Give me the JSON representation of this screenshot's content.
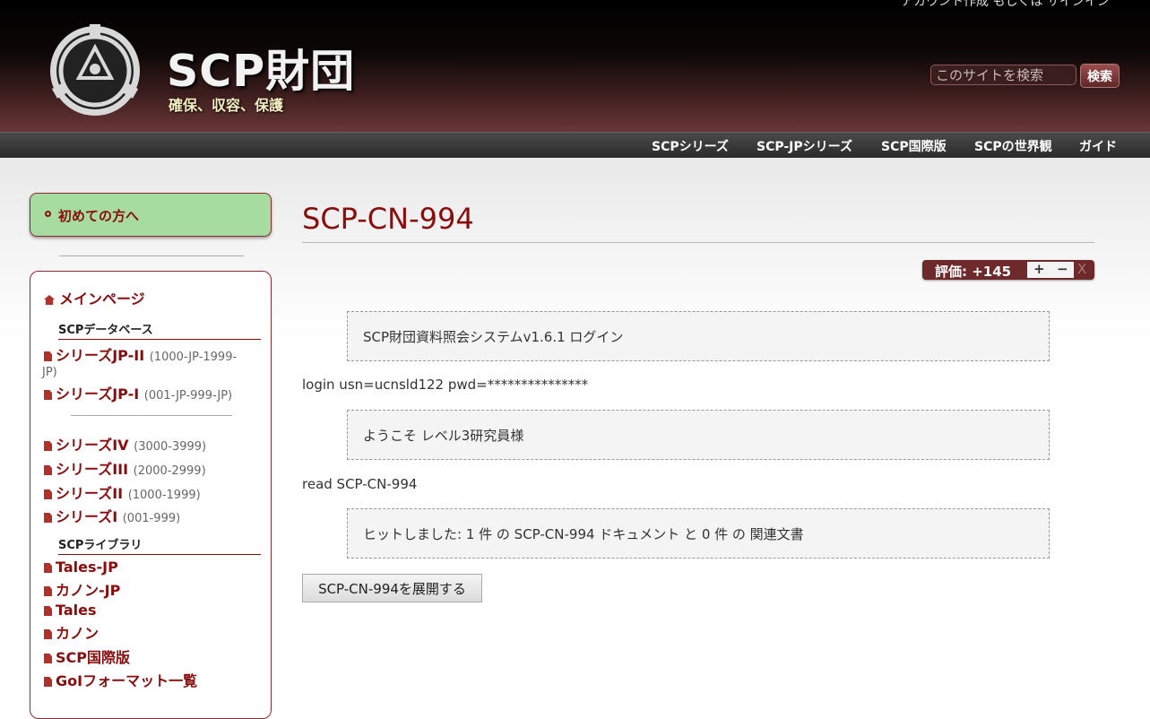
{
  "header": {
    "site_name": "SCP財団",
    "slogan": "確保、収容、保護",
    "top_right_text": "アカウント作成 もしくは サインイン",
    "search": {
      "placeholder": "このサイトを検索",
      "button_label": "検索"
    }
  },
  "topnav": [
    "SCPシリーズ",
    "SCP-JPシリーズ",
    "SCP国際版",
    "SCPの世界観",
    "ガイド"
  ],
  "sidebar": {
    "first_time": "初めての方へ",
    "main_page": "メインページ",
    "db_heading": "SCPデータベース",
    "db_items": [
      {
        "label": "シリーズJP-II",
        "sub": "(1000-JP-1999-"
      },
      {
        "label": "JP)"
      },
      {
        "label": "シリーズJP-I",
        "sub": "(001-JP-999-JP)"
      },
      {
        "label": "シリーズIV",
        "sub": "(3000-3999)"
      },
      {
        "label": "シリーズIII",
        "sub": "(2000-2999)"
      },
      {
        "label": "シリーズII",
        "sub": "(1000-1999)"
      },
      {
        "label": "シリーズI",
        "sub": "(001-999)"
      }
    ],
    "lib_heading": "SCPライブラリ",
    "lib_items": [
      "Tales-JP",
      "カノン-JP",
      "Tales",
      "カノン",
      "SCP国際版",
      "GoIフォーマット一覧"
    ]
  },
  "main": {
    "title": "SCP-CN-994",
    "rating_label": "評価: +145",
    "rating_plus": "+",
    "rating_minus": "−",
    "rating_x": "X",
    "terminal": {
      "box1": "SCP財団資料照会システムv1.6.1 ログイン",
      "line1": "login usn=ucnsld122 pwd=***************",
      "box2": "ようこそ レベル3研究員様",
      "line2": "read SCP-CN-994",
      "box3": "ヒットしました: 1 件 の SCP-CN-994 ドキュメント と 0 件 の 関連文書"
    },
    "expand_button": "SCP-CN-994を展開する"
  }
}
